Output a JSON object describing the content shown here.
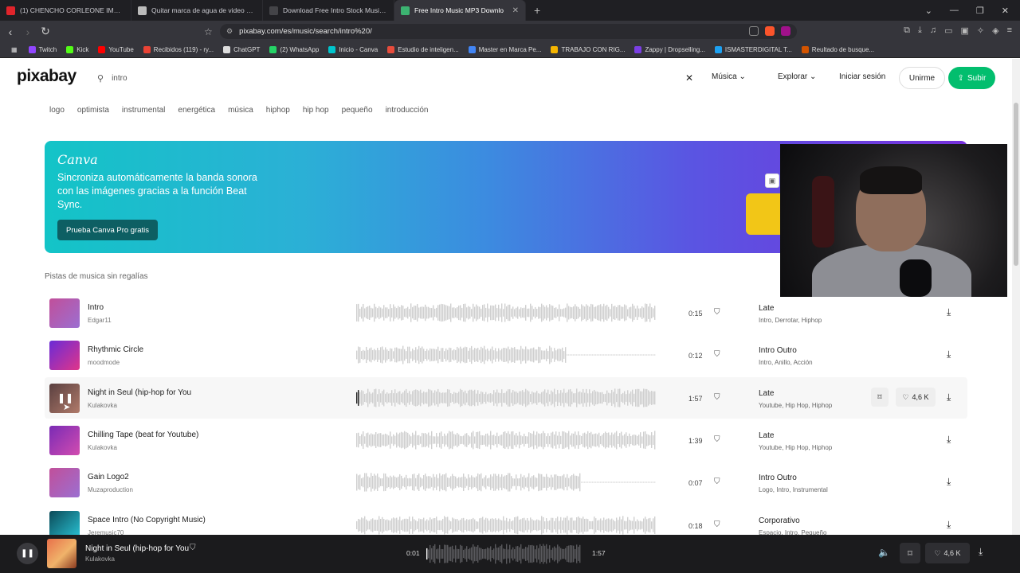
{
  "browser": {
    "tabs": [
      {
        "title": "(1) CHENCHO CORLEONE IMPAC",
        "color": "#e0242b",
        "active": false
      },
      {
        "title": "Quitar marca de agua de video Gem",
        "color": "#bbbbbb",
        "active": false
      },
      {
        "title": "Download Free Intro Stock Music MP",
        "color": "#444448",
        "active": false
      },
      {
        "title": "Free Intro Music MP3 Downlo",
        "color": "#3cb371",
        "active": true
      }
    ],
    "url": "pixabay.com/es/music/search/intro%20/",
    "bookmarks": [
      {
        "label": "Twitch",
        "color": "#9146ff"
      },
      {
        "label": "Kick",
        "color": "#53fc18"
      },
      {
        "label": "YouTube",
        "color": "#ff0000"
      },
      {
        "label": "Recibidos (119) - ry...",
        "color": "#ea4335"
      },
      {
        "label": "ChatGPT",
        "color": "#dddddd"
      },
      {
        "label": "(2) WhatsApp",
        "color": "#25d366"
      },
      {
        "label": "Inicio - Canva",
        "color": "#00c4cc"
      },
      {
        "label": "Estudio de inteligen...",
        "color": "#e74c3c"
      },
      {
        "label": "Master en Marca Pe...",
        "color": "#4285f4"
      },
      {
        "label": "TRABAJO CON RIG...",
        "color": "#f4b400"
      },
      {
        "label": "Zappy | Dropselling...",
        "color": "#7b3fe4"
      },
      {
        "label": "ISMASTERDIGITAL T...",
        "color": "#1da1f2"
      },
      {
        "label": "Reultado de busque...",
        "color": "#d35400"
      }
    ]
  },
  "header": {
    "logo": "pixabay",
    "search_value": "intro",
    "media_type": "Música",
    "explore": "Explorar",
    "login": "Iniciar sesión",
    "join": "Unirme",
    "upload": "Subir"
  },
  "tags": [
    "logo",
    "optimista",
    "instrumental",
    "energética",
    "música",
    "hiphop",
    "hip hop",
    "pequeño",
    "introducción"
  ],
  "banner": {
    "brand": "Canva",
    "message": "Sincroniza automáticamente la banda sonora con las imágenes gracias a la función Beat Sync.",
    "cta": "Prueba Canva Pro gratis"
  },
  "section_title": "Pistas de musica sin regalías",
  "tracks": [
    {
      "name": "Intro",
      "author": "Edgar11",
      "duration": "0:15",
      "category": "Late",
      "tags": "Intro, Derrotar, Hiphop",
      "thumb": "linear-gradient(135deg,#c14f9a,#9b6fd1)",
      "wave_fill": 1.0
    },
    {
      "name": "Rhythmic Circle",
      "author": "moodmode",
      "duration": "0:12",
      "category": "Intro Outro",
      "tags": "Intro, Anillo, Acción",
      "thumb": "linear-gradient(135deg,#6a2bd6,#e0358a)",
      "wave_fill": 0.7
    },
    {
      "name": "Night in Seul (hip-hop for You",
      "author": "Kulakovka",
      "duration": "1:57",
      "category": "Late",
      "tags": "Youtube, Hip Hop, Hiphop",
      "thumb": "linear-gradient(135deg,#5a4040,#b07a6a)",
      "wave_fill": 1.0,
      "likes": "4,6 K"
    },
    {
      "name": "Chilling Tape (beat for Youtube)",
      "author": "Kulakovka",
      "duration": "1:39",
      "category": "Late",
      "tags": "Youtube, Hip Hop, Hiphop",
      "thumb": "linear-gradient(135deg,#7a2bb5,#d24cb0)",
      "wave_fill": 1.0
    },
    {
      "name": "Gain Logo2",
      "author": "Muzaproduction",
      "duration": "0:07",
      "category": "Intro Outro",
      "tags": "Logo, Intro, Instrumental",
      "thumb": "linear-gradient(135deg,#c14f9a,#9b6fd1)",
      "wave_fill": 0.75
    },
    {
      "name": "Space Intro (No Copyright Music)",
      "author": "Jeremusic70",
      "duration": "0:18",
      "category": "Corporativo",
      "tags": "Espacio, Intro, Pequeño",
      "thumb": "linear-gradient(135deg,#0b4a58,#2ac6d8)",
      "wave_fill": 1.0
    }
  ],
  "player": {
    "title": "Night in Seul (hip-hop for You",
    "author": "Kulakovka",
    "current_time": "0:01",
    "total_time": "1:57",
    "likes": "4,6 K",
    "progress": 0.01
  }
}
